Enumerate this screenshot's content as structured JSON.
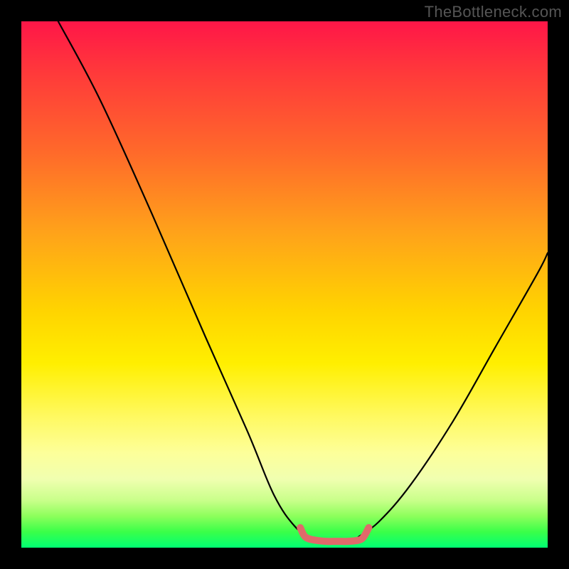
{
  "watermark": "TheBottleneck.com",
  "chart_data": {
    "type": "line",
    "title": "",
    "xlabel": "",
    "ylabel": "",
    "xlim": [
      0,
      100
    ],
    "ylim": [
      0,
      100
    ],
    "grid": false,
    "legend": false,
    "annotations": [],
    "series": [
      {
        "name": "left-curve",
        "x": [
          7,
          15,
          25,
          35,
          43,
          48,
          52,
          55
        ],
        "values": [
          100,
          85,
          63,
          40,
          22,
          10,
          4,
          2
        ]
      },
      {
        "name": "right-curve",
        "x": [
          64,
          68,
          74,
          82,
          90,
          98,
          100
        ],
        "values": [
          2,
          5,
          12,
          24,
          38,
          52,
          56
        ]
      },
      {
        "name": "bottom-bracket",
        "x": [
          53,
          54,
          56,
          58,
          60,
          62,
          64,
          65,
          66
        ],
        "values": [
          3.8,
          2.0,
          1.4,
          1.2,
          1.2,
          1.2,
          1.4,
          2.0,
          3.8
        ]
      }
    ],
    "gradient_stops": [
      {
        "pos": 0,
        "color": "#ff1648"
      },
      {
        "pos": 10,
        "color": "#ff3a3a"
      },
      {
        "pos": 25,
        "color": "#ff6a2a"
      },
      {
        "pos": 40,
        "color": "#ffa21a"
      },
      {
        "pos": 55,
        "color": "#ffd400"
      },
      {
        "pos": 65,
        "color": "#ffef00"
      },
      {
        "pos": 75,
        "color": "#fff960"
      },
      {
        "pos": 82,
        "color": "#fdff9a"
      },
      {
        "pos": 87,
        "color": "#f0ffb0"
      },
      {
        "pos": 91,
        "color": "#c9ff8a"
      },
      {
        "pos": 94,
        "color": "#8dff5c"
      },
      {
        "pos": 97,
        "color": "#3aff49"
      },
      {
        "pos": 100,
        "color": "#00ff73"
      }
    ],
    "colors": {
      "curve": "#000000",
      "bracket": "#e06a6a",
      "frame": "#000000"
    }
  }
}
